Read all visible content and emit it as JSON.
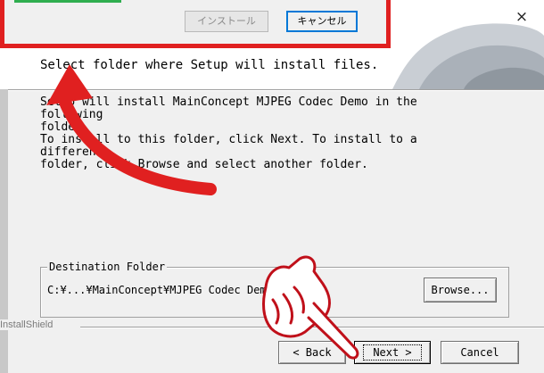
{
  "header": {
    "close_glyph": "×",
    "title": "Select folder where Setup will install files."
  },
  "body": {
    "paragraph1": "Setup will install MainConcept MJPEG Codec Demo in the following\nfolder.",
    "paragraph2": "To install to this folder, click Next. To install to a different\nfolder, click Browse and select another folder."
  },
  "destination": {
    "legend": "Destination Folder",
    "path": "C:¥...¥MainConcept¥MJPEG Codec Demo",
    "browse_label": "Browse..."
  },
  "footer": {
    "brand": "InstallShield",
    "back_label": "< Back",
    "next_label": "Next >",
    "cancel_label": "Cancel"
  },
  "overlay_dialog": {
    "install_label": "インストール",
    "cancel_label": "キャンセル",
    "frame_color": "#e02020"
  },
  "annotations": {
    "arrow": "red-curved-arrow",
    "hand": "pointing-hand-icon",
    "arrow_color": "#e02020"
  }
}
